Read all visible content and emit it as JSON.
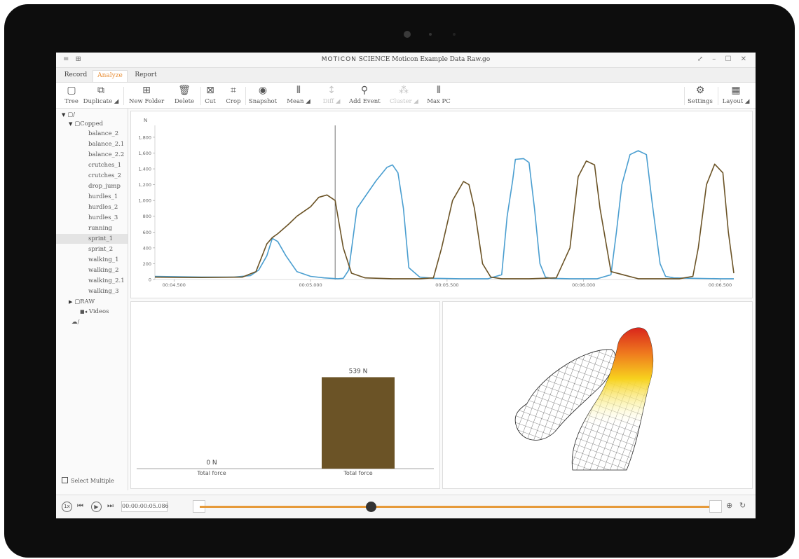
{
  "window": {
    "brand": "MOTICON",
    "title": "SCIENCE Moticon Example Data Raw.go",
    "menu_glyph": "≡ ⊞",
    "controls": "⤢ – ☐ ✕"
  },
  "tabs": [
    {
      "label": "Record",
      "active": false
    },
    {
      "label": "Analyze",
      "active": true
    },
    {
      "label": "Report",
      "active": false
    }
  ],
  "toolbar": [
    {
      "label": "Tree",
      "icon": "panel-icon",
      "glyph": "▢"
    },
    {
      "label": "Duplicate ◢",
      "icon": "duplicate-icon",
      "glyph": "⧉"
    },
    {
      "label": "New Folder",
      "icon": "new-folder-icon",
      "glyph": "⊞"
    },
    {
      "label": "Delete",
      "icon": "trash-icon",
      "glyph": "🗑"
    },
    {
      "label": "Cut",
      "icon": "cut-icon",
      "glyph": "⊠"
    },
    {
      "label": "Crop",
      "icon": "crop-icon",
      "glyph": "⌗"
    },
    {
      "label": "Snapshot",
      "icon": "snapshot-icon",
      "glyph": "◉"
    },
    {
      "label": "Mean ◢",
      "icon": "insoles-icon",
      "glyph": "⦀"
    },
    {
      "label": "Diff ◢",
      "icon": "diff-icon",
      "glyph": "↕",
      "disabled": true
    },
    {
      "label": "Add Event",
      "icon": "pin-icon",
      "glyph": "⚲"
    },
    {
      "label": "Cluster ◢",
      "icon": "cluster-icon",
      "glyph": "⁂",
      "disabled": true
    },
    {
      "label": "Max PC",
      "icon": "insoles-icon",
      "glyph": "⦀"
    },
    {
      "label": "Settings",
      "icon": "gear-icon",
      "glyph": "⚙"
    },
    {
      "label": "Layout ◢",
      "icon": "layout-icon",
      "glyph": "▦"
    }
  ],
  "tree": {
    "root": "▢/",
    "folders": [
      {
        "label": "▢Copped",
        "expanded": true,
        "items": [
          "balance_2",
          "balance_2.1",
          "balance_2.2",
          "crutches_1",
          "crutches_2",
          "drop_jump",
          "hurdles_1",
          "hurdles_2",
          "hurdles_3",
          "running",
          "sprint_1",
          "sprint_2",
          "walking_1",
          "walking_2",
          "walking_2.1",
          "walking_3"
        ],
        "selected": "sprint_1"
      },
      {
        "label": "▢RAW",
        "expanded": false
      },
      {
        "label": "Videos",
        "icon": "camera-icon"
      }
    ],
    "cloud": "☁/",
    "select_multiple": "Select Multiple"
  },
  "chart_data": [
    {
      "type": "line",
      "ylabel": "N",
      "ylim": [
        0,
        1950
      ],
      "yticks": [
        0,
        200,
        400,
        600,
        800,
        "1,000",
        "1,200",
        "1,400",
        "1,600",
        "1,800"
      ],
      "ytick_values": [
        0,
        200,
        400,
        600,
        800,
        1000,
        1200,
        1400,
        1600,
        1800
      ],
      "xlim": [
        4.43,
        6.55
      ],
      "xticks": [
        {
          "t": 4.5,
          "label": "00:04.500"
        },
        {
          "t": 5.0,
          "label": "00:05.000"
        },
        {
          "t": 5.5,
          "label": "00:05.500"
        },
        {
          "t": 6.0,
          "label": "00:06.000"
        },
        {
          "t": 6.5,
          "label": "00:06.500"
        }
      ],
      "cursor": 5.09,
      "series": [
        {
          "color": "#4a9ed0",
          "x": [
            4.43,
            4.6,
            4.72,
            4.78,
            4.81,
            4.84,
            4.86,
            4.88,
            4.91,
            4.95,
            5.0,
            5.05,
            5.1,
            5.12,
            5.14,
            5.17,
            5.2,
            5.24,
            5.28,
            5.3,
            5.32,
            5.34,
            5.36,
            5.4,
            5.45,
            5.55,
            5.65,
            5.7,
            5.72,
            5.74,
            5.75,
            5.78,
            5.8,
            5.82,
            5.84,
            5.86,
            5.88,
            5.95,
            6.05,
            6.1,
            6.12,
            6.14,
            6.17,
            6.2,
            6.23,
            6.25,
            6.28,
            6.3,
            6.33,
            6.4,
            6.5,
            6.55
          ],
          "y": [
            40,
            30,
            30,
            50,
            120,
            300,
            520,
            480,
            300,
            100,
            40,
            20,
            10,
            15,
            120,
            900,
            1050,
            1250,
            1420,
            1450,
            1350,
            900,
            150,
            30,
            15,
            10,
            10,
            60,
            800,
            1250,
            1520,
            1530,
            1480,
            900,
            200,
            30,
            15,
            10,
            10,
            60,
            600,
            1200,
            1580,
            1630,
            1580,
            1000,
            200,
            40,
            20,
            15,
            10,
            10
          ]
        },
        {
          "color": "#6b5326",
          "x": [
            4.43,
            4.6,
            4.75,
            4.8,
            4.84,
            4.86,
            4.88,
            4.92,
            4.95,
            5.0,
            5.03,
            5.06,
            5.09,
            5.12,
            5.15,
            5.2,
            5.3,
            5.4,
            5.45,
            5.48,
            5.52,
            5.56,
            5.58,
            5.6,
            5.63,
            5.66,
            5.7,
            5.8,
            5.9,
            5.95,
            5.98,
            6.01,
            6.04,
            6.06,
            6.1,
            6.2,
            6.35,
            6.4,
            6.42,
            6.45,
            6.48,
            6.51,
            6.53,
            6.55
          ],
          "y": [
            30,
            25,
            30,
            100,
            450,
            530,
            580,
            700,
            800,
            920,
            1040,
            1070,
            1000,
            400,
            80,
            20,
            10,
            10,
            20,
            400,
            1000,
            1240,
            1200,
            900,
            200,
            30,
            10,
            10,
            20,
            400,
            1300,
            1500,
            1450,
            900,
            100,
            10,
            10,
            40,
            400,
            1200,
            1460,
            1350,
            600,
            80
          ]
        }
      ]
    },
    {
      "type": "bar",
      "categories": [
        "Total force",
        "Total force"
      ],
      "values": [
        0,
        539
      ],
      "value_labels": [
        "0 N",
        "539 N"
      ],
      "ylim": [
        0,
        900
      ],
      "colors": [
        "#6b5326",
        "#6b5326"
      ]
    }
  ],
  "timeline": {
    "speed": "1x",
    "time": "00:00:00:05.086",
    "position": 0.33,
    "accent": "#e69a3a"
  },
  "colors": {
    "accent": "#e8903a",
    "blue_series": "#4a9ed0",
    "brown_series": "#6b5326"
  }
}
